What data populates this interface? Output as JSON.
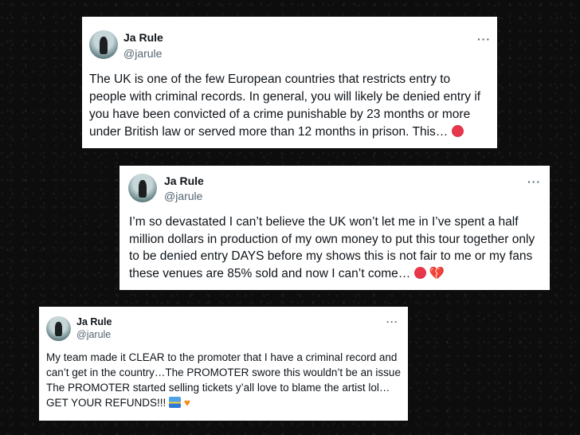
{
  "tweets": [
    {
      "name": "Ja Rule",
      "handle": "@jarule",
      "more": "···",
      "text": "The UK is one of the few European countries that restricts entry to people with criminal records. In general, you will likely be denied entry if you have been convicted of a crime punishable by 23 months or more under British law or served more than 12 months in prison. This…",
      "emoji": [
        "angry-face-icon"
      ]
    },
    {
      "name": "Ja Rule",
      "handle": "@jarule",
      "more": "···",
      "text": "I’m so devastated I can’t believe the UK won’t let me in I’ve spent a half million dollars in production of my own money to put this tour together only to be denied entry DAYS before my shows this is not fair to me or my fans these venues are 85% sold and now I can’t come…",
      "emoji": [
        "angry-face-icon",
        "broken-heart-icon"
      ]
    },
    {
      "name": "Ja Rule",
      "handle": "@jarule",
      "more": "···",
      "text": "My team made it CLEAR to the promoter that I have a criminal record and can’t get in the country…The PROMOTER swore this wouldn’t be an issue The PROMOTER started selling tickets y’all love to blame the artist lol… GET YOUR REFUNDS!!!",
      "emoji": [
        "sunrise-icon",
        "orange-heart-icon"
      ]
    }
  ],
  "colors": {
    "background": "#0d0d0d",
    "card": "#ffffff",
    "text": "#0f1419",
    "secondary": "#536471"
  }
}
